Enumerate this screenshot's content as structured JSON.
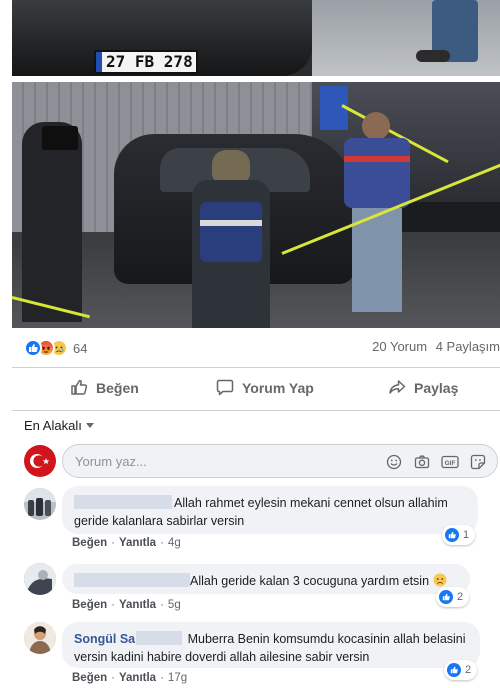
{
  "photos": {
    "top_plate": "27 FB 278"
  },
  "post_stats": {
    "reaction_icons": [
      "like-icon",
      "angry-icon",
      "sad-icon"
    ],
    "reaction_count": "64",
    "comments": "20 Yorum",
    "shares": "4 Paylaşım"
  },
  "actions": {
    "like": "Beğen",
    "comment": "Yorum Yap",
    "share": "Paylaş"
  },
  "comments_section": {
    "sort_label": "En Alakalı",
    "input_placeholder": "Yorum yaz...",
    "input_icons": [
      "emoji-icon",
      "camera-icon",
      "gif-icon",
      "sticker-icon"
    ],
    "items": [
      {
        "author": "",
        "text": "Allah rahmet eylesin mekani cennet olsun allahim geride kalanlara sabirlar versin",
        "like_label": "Beğen",
        "reply_label": "Yanıtla",
        "time": "4g",
        "reaction_icon": "like-icon",
        "reaction_count": "1"
      },
      {
        "author": "",
        "text": "Allah geride kalan 3 cocuguna yardım etsin",
        "like_label": "Beğen",
        "reply_label": "Yanıtla",
        "time": "5g",
        "reaction_icon": "like-icon",
        "reaction_count": "2"
      },
      {
        "author": "Songül Sa",
        "text": "Muberra Benin komsumdu kocasinin allah belasini versin kadini habire doverdi allah ailesine sabir versin",
        "like_label": "Beğen",
        "reply_label": "Yanıtla",
        "time": "17g",
        "reaction_icon": "like-icon",
        "reaction_count": "2"
      }
    ]
  },
  "colors": {
    "link_blue": "#385898",
    "fb_blue": "#1877f2",
    "secondary_text": "#65676b",
    "bubble_bg": "#f0f2f5"
  }
}
